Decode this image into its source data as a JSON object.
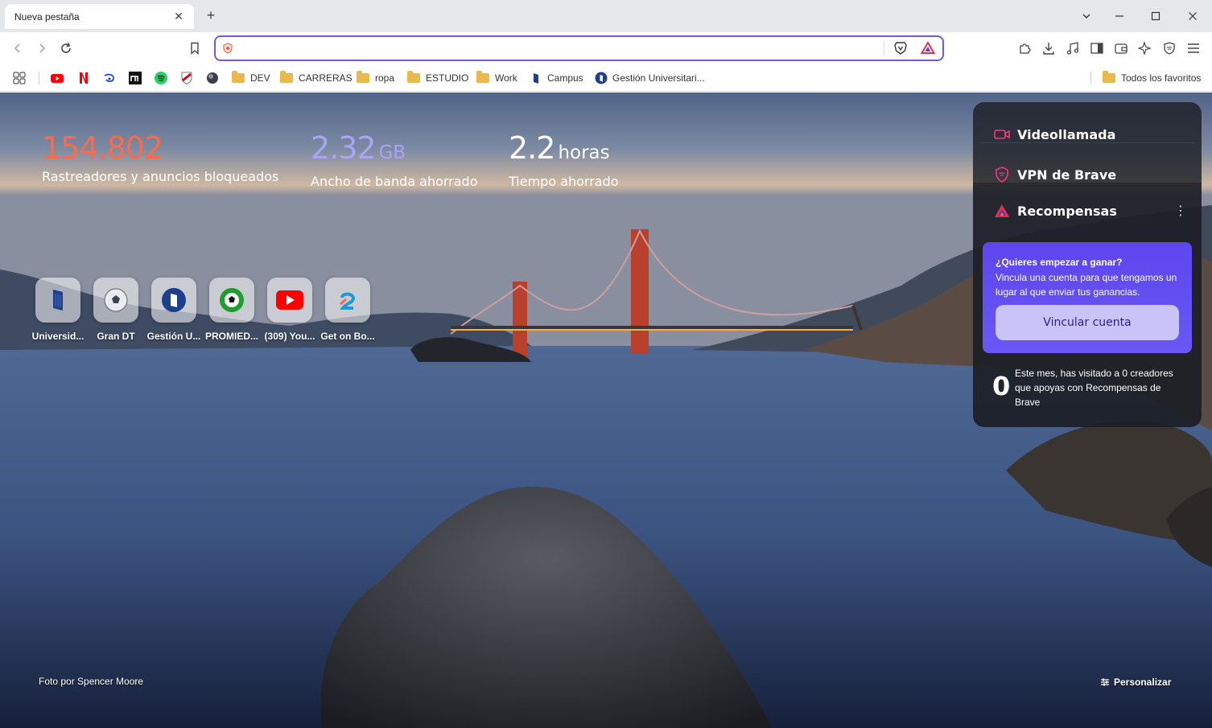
{
  "window": {
    "tab_title": "Nueva pestaña",
    "controls": [
      "chevron-down-icon",
      "minimize-icon",
      "maximize-icon",
      "close-icon"
    ]
  },
  "toolbar": {
    "url_value": "",
    "url_placeholder": "",
    "accent": "#6f5bd9"
  },
  "bookmarks": {
    "items": [
      {
        "label": "DEV",
        "kind": "folder"
      },
      {
        "label": "CARRERAS",
        "kind": "folder"
      },
      {
        "label": "ropa",
        "kind": "folder"
      },
      {
        "label": "ESTUDIO",
        "kind": "folder"
      },
      {
        "label": "Work",
        "kind": "folder"
      },
      {
        "label": "Campus",
        "kind": "link"
      },
      {
        "label": "Gestión Universitari...",
        "kind": "link"
      }
    ],
    "all_bookmarks": "Todos los favoritos"
  },
  "stats": [
    {
      "value": "154.802",
      "unit": "",
      "label": "Rastreadores y anuncios bloqueados",
      "color": "#fb6a4a"
    },
    {
      "value": "2.32",
      "unit": "GB",
      "label": "Ancho de banda ahorrado",
      "color": "#a8a5f2"
    },
    {
      "value": "2.2",
      "unit": "horas",
      "label": "Tiempo ahorrado",
      "color": "#ffffff"
    }
  ],
  "top_sites": [
    {
      "label": "Universid..."
    },
    {
      "label": "Gran DT"
    },
    {
      "label": "Gestión U..."
    },
    {
      "label": "PROMIED..."
    },
    {
      "label": "(309) You..."
    },
    {
      "label": "Get on Bo..."
    }
  ],
  "cards": {
    "video_call": "Videollamada",
    "vpn": "VPN de Brave",
    "rewards": {
      "title": "Recompensas",
      "promo_heading": "¿Quieres empezar a ganar?",
      "promo_text": "Vincula una cuenta para que tengamos un lugar al que enviar tus ganancias.",
      "promo_button": "Vincular cuenta",
      "creators_count": "0",
      "creators_text": "Este mes, has visitado a 0 creadores que apoyas con Recompensas de Brave"
    }
  },
  "footer": {
    "photo_credit": "Foto por Spencer Moore",
    "customize": "Personalizar"
  }
}
